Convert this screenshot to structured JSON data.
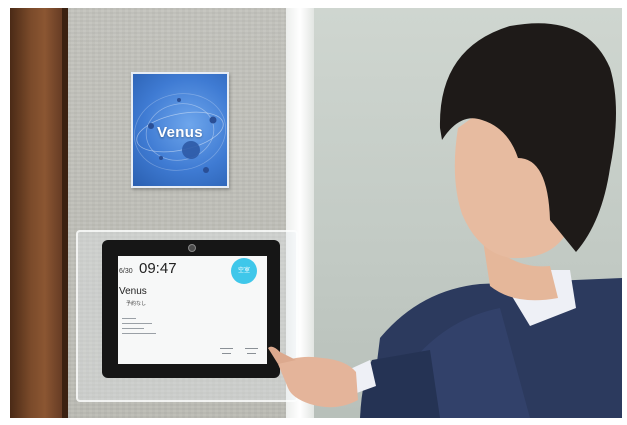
{
  "sign": {
    "room_name": "Venus",
    "colors": {
      "background": "#3f7bd3",
      "text": "#ffffff"
    }
  },
  "tablet": {
    "date": "6/30",
    "time": "09:47",
    "status_label": "空室",
    "status_color": "#3fc7ea",
    "room_name": "Venus",
    "reservation_note": "予約なし"
  }
}
